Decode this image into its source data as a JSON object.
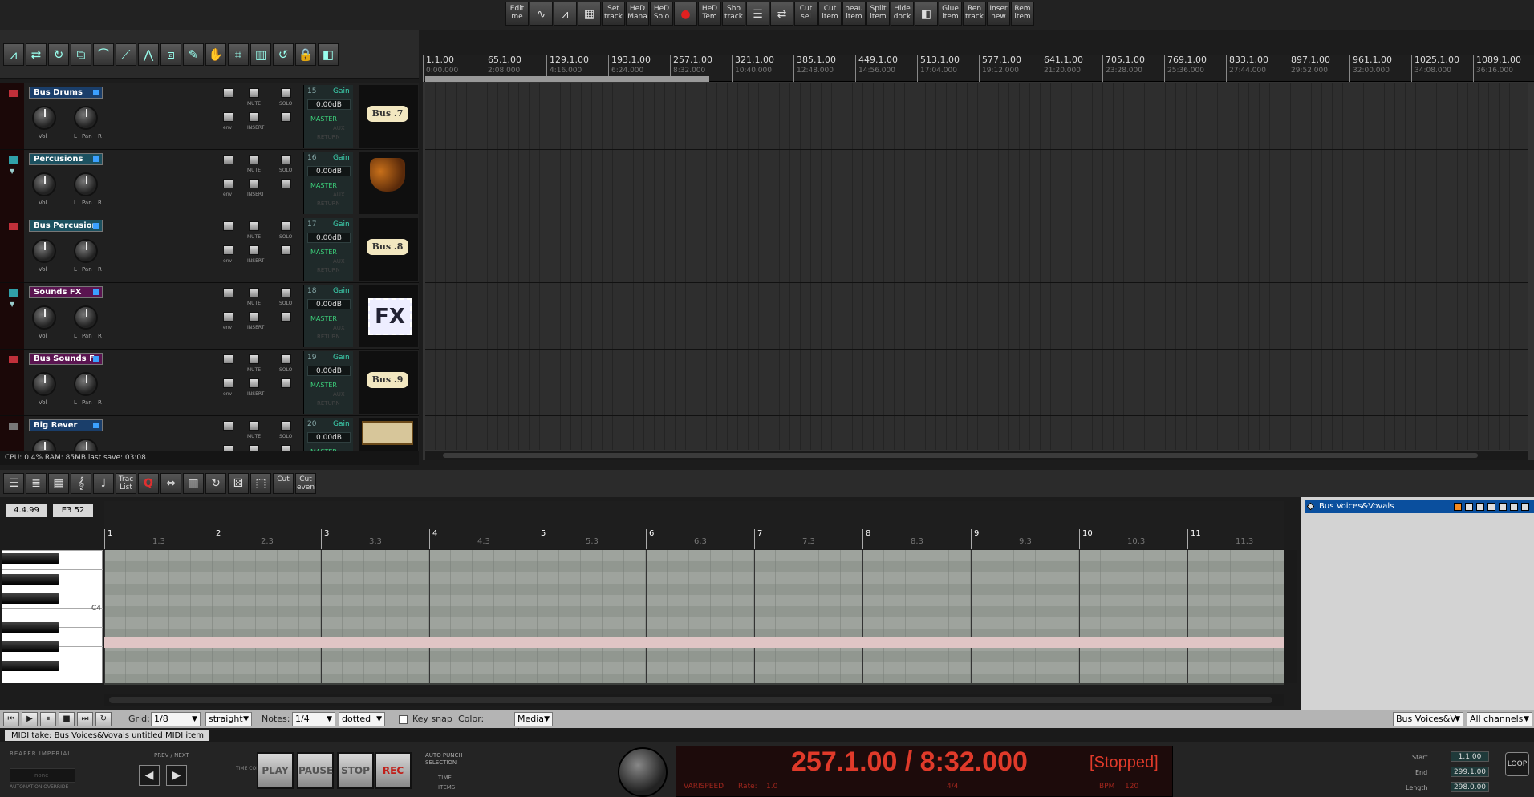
{
  "toolbar": {
    "buttons": [
      {
        "label": "Edit me"
      },
      {
        "label": "",
        "icon": "waveform-icon"
      },
      {
        "label": "",
        "icon": "envelope-icon"
      },
      {
        "label": "",
        "icon": "color-icon"
      },
      {
        "label": "Set track"
      },
      {
        "label": "HeD Mana"
      },
      {
        "label": "HeD Solo"
      },
      {
        "label": "",
        "icon": "record-icon"
      },
      {
        "label": "HeD Tem"
      },
      {
        "label": "Sho track"
      },
      {
        "label": "",
        "icon": "grid-icon"
      },
      {
        "label": "",
        "icon": "route-icon"
      },
      {
        "label": "Cut sel"
      },
      {
        "label": "Cut item"
      },
      {
        "label": "beau item"
      },
      {
        "label": "Split item"
      },
      {
        "label": "Hide dock"
      },
      {
        "label": "",
        "icon": "palette-icon"
      },
      {
        "label": "Glue item"
      },
      {
        "label": "Ren track"
      },
      {
        "label": "Inser new"
      },
      {
        "label": "Rem item"
      }
    ]
  },
  "track_tools": [
    "waveform-tool-icon",
    "route-tool-icon",
    "loop-tool-icon",
    "copy-tool-icon",
    "snap-tool-icon",
    "envelope-tool-icon",
    "ripple-tool-icon",
    "group-tool-icon",
    "draw-tool-icon",
    "hand-tool-icon",
    "crossfade-tool-icon",
    "grid-tool-icon",
    "undo-tool-icon",
    "lock-tool-icon",
    "color-tool-icon"
  ],
  "tracks": [
    {
      "name": "Bus Drums",
      "num": "15",
      "gain_label": "Gain",
      "gain": "0.00dB",
      "badge": "Bus .7",
      "name_color": "#1a3e6a",
      "fold": "folder-red"
    },
    {
      "name": "Percusions",
      "num": "16",
      "gain_label": "Gain",
      "gain": "0.00dB",
      "badge": "",
      "name_color": "#1c5160",
      "fold": "folder-teal"
    },
    {
      "name": "Bus Percusior",
      "num": "17",
      "gain_label": "Gain",
      "gain": "0.00dB",
      "badge": "Bus .8",
      "name_color": "#1c5160",
      "fold": "folder-red"
    },
    {
      "name": "Sounds FX",
      "num": "18",
      "gain_label": "Gain",
      "gain": "0.00dB",
      "badge": "FX",
      "name_color": "#5a1450",
      "fold": "folder-teal"
    },
    {
      "name": "Bus Sounds F",
      "num": "19",
      "gain_label": "Gain",
      "gain": "0.00dB",
      "badge": "Bus .9",
      "name_color": "#5a1450",
      "fold": "folder-red"
    },
    {
      "name": "Big Rever",
      "num": "20",
      "gain_label": "Gain",
      "gain": "0.00dB",
      "badge": "",
      "name_color": "#1a3e6a",
      "fold": "folder-grey"
    }
  ],
  "track_labels": {
    "vol": "Vol",
    "pan": "Pan",
    "mute": "MUTE",
    "solo": "SOLO",
    "env": "env",
    "insert": "INSERT",
    "master": "MASTER",
    "aux": "AUX",
    "return": "RETURN",
    "l": "L",
    "r": "R"
  },
  "status": "CPU: 0.4%  RAM: 85MB  last save: 03:08",
  "ruler": [
    {
      "m": "1.1.00",
      "t": "0:00.000"
    },
    {
      "m": "65.1.00",
      "t": "2:08.000"
    },
    {
      "m": "129.1.00",
      "t": "4:16.000"
    },
    {
      "m": "193.1.00",
      "t": "6:24.000"
    },
    {
      "m": "257.1.00",
      "t": "8:32.000"
    },
    {
      "m": "321.1.00",
      "t": "10:40.000"
    },
    {
      "m": "385.1.00",
      "t": "12:48.000"
    },
    {
      "m": "449.1.00",
      "t": "14:56.000"
    },
    {
      "m": "513.1.00",
      "t": "17:04.000"
    },
    {
      "m": "577.1.00",
      "t": "19:12.000"
    },
    {
      "m": "641.1.00",
      "t": "21:20.000"
    },
    {
      "m": "705.1.00",
      "t": "23:28.000"
    },
    {
      "m": "769.1.00",
      "t": "25:36.000"
    },
    {
      "m": "833.1.00",
      "t": "27:44.000"
    },
    {
      "m": "897.1.00",
      "t": "29:52.000"
    },
    {
      "m": "961.1.00",
      "t": "32:00.000"
    },
    {
      "m": "1025.1.00",
      "t": "34:08.000"
    },
    {
      "m": "1089.1.00",
      "t": "36:16.000"
    },
    {
      "m": "11",
      "t": ""
    }
  ],
  "midi_tools": [
    {
      "label": "",
      "icon": "list-view-icon"
    },
    {
      "label": "",
      "icon": "event-list-icon"
    },
    {
      "label": "",
      "icon": "grid-view-icon"
    },
    {
      "label": "",
      "icon": "notation-icon"
    },
    {
      "label": "",
      "icon": "pitch-icon"
    },
    {
      "label": "Trac List"
    },
    {
      "label": "Q"
    },
    {
      "label": "",
      "icon": "stretch-icon"
    },
    {
      "label": "",
      "icon": "keyboard-icon"
    },
    {
      "label": "",
      "icon": "loop-icon"
    },
    {
      "label": "",
      "icon": "dice-icon"
    },
    {
      "label": "",
      "icon": "select-icon"
    },
    {
      "label": "Cut"
    },
    {
      "label": "Cut even"
    }
  ],
  "midi": {
    "pos": "4.4.99",
    "note": "E3  52",
    "c4": "C4",
    "bars": [
      "1",
      "2",
      "3",
      "4",
      "5",
      "6",
      "7",
      "8",
      "9",
      "10",
      "11"
    ],
    "sub": [
      "1.3",
      "2.3",
      "3.3",
      "4.3",
      "5.3",
      "6.3",
      "7.3",
      "8.3",
      "9.3",
      "10.3",
      "11.3"
    ],
    "track_item": "Bus Voices&Vovals",
    "take": "MIDI take: Bus Voices&Vovals untitled MIDI item"
  },
  "midi_bottom": {
    "grid_label": "Grid:",
    "grid": "1/8",
    "swing": "straight",
    "notes_label": "Notes:",
    "notes": "1/4",
    "notes_mode": "dotted",
    "keysnap": "Key snap",
    "color_label": "Color:",
    "color": "Media item",
    "track": "Bus Voices&V",
    "channels": "All channels"
  },
  "transport": {
    "brand": "REAPER IMPERIAL",
    "auto_override": "AUTOMATION OVERRIDE",
    "auto_box": "none",
    "prev_next": "PREV / NEXT",
    "timecode": "TIME CODE",
    "play": "PLAY",
    "pause": "PAUSE",
    "stop": "STOP",
    "rec": "REC",
    "auto_punch": "AUTO PUNCH SELECTION",
    "ap_time": "TIME",
    "ap_items": "ITEMS",
    "time": "257.1.00 / 8:32.000",
    "state": "[Stopped]",
    "varispeed": "VARISPEED",
    "rate_label": "Rate:",
    "rate": "1.0",
    "sig": "4/4",
    "bpm_label": "BPM",
    "bpm": "120",
    "start_label": "Start",
    "start": "1.1.00",
    "end_label": "End",
    "end": "299.1.00",
    "length_label": "Length",
    "length": "298.0.00",
    "loop": "LOOP"
  }
}
